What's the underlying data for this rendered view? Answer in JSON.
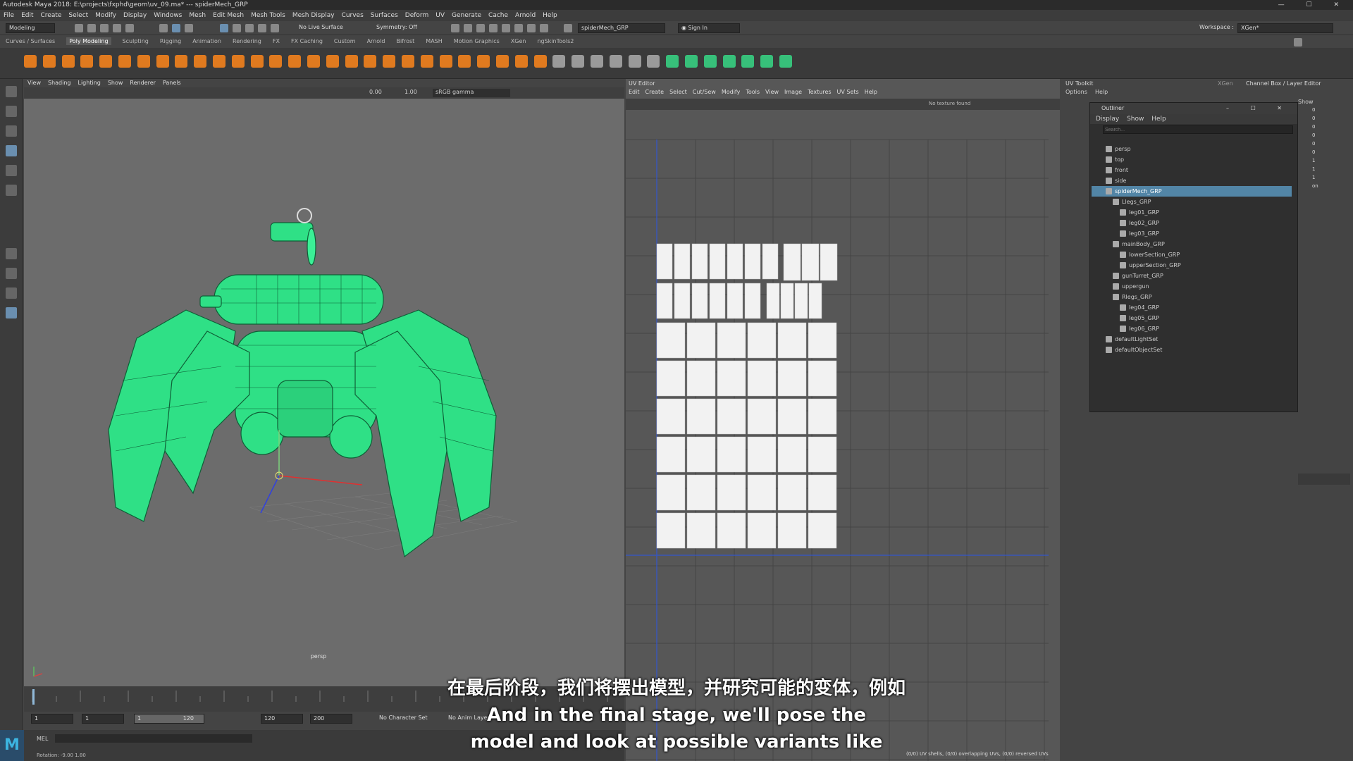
{
  "window_title": "Autodesk Maya 2018: E:\\projects\\fxphd\\geom\\uv_09.ma*   ---   spiderMech_GRP",
  "menus": [
    "File",
    "Edit",
    "Create",
    "Select",
    "Modify",
    "Display",
    "Windows",
    "Mesh",
    "Edit Mesh",
    "Mesh Tools",
    "Mesh Display",
    "Curves",
    "Surfaces",
    "Deform",
    "UV",
    "Generate",
    "Cache",
    "Arnold",
    "Help"
  ],
  "statusline": {
    "mode": "Modeling",
    "live_surface": "No Live Surface",
    "symmetry": "Symmetry: Off",
    "object_field": "spiderMech_GRP",
    "sign_in": "Sign In",
    "workspace_label": "Workspace :",
    "workspace_value": "XGen*"
  },
  "shelf_tabs": [
    "Curves / Surfaces",
    "Poly Modeling",
    "Sculpting",
    "Rigging",
    "Animation",
    "Rendering",
    "FX",
    "FX Caching",
    "Custom",
    "Arnold",
    "Bifrost",
    "MASH",
    "Motion Graphics",
    "XGen",
    "ngSkinTools2"
  ],
  "shelf_active": "Poly Modeling",
  "viewport": {
    "menus": [
      "View",
      "Shading",
      "Lighting",
      "Show",
      "Renderer",
      "Panels"
    ],
    "exposure": "0.00",
    "gamma": "1.00",
    "colorspace": "sRGB gamma",
    "camera_label": "persp"
  },
  "uv_editor": {
    "title": "UV Editor",
    "menus": [
      "Edit",
      "Create",
      "Select",
      "Cut/Sew",
      "Modify",
      "Tools",
      "View",
      "Image",
      "Textures",
      "UV Sets",
      "Help"
    ],
    "texture_status": "No texture found",
    "status_text": "(0/0) UV shells, (0/0) overlapping UVs, (0/0) reversed UVs"
  },
  "uv_toolkit": {
    "title": "UV Toolkit",
    "xgen_tab": "XGen",
    "channel_box_tab": "Channel Box / Layer Editor",
    "menus": [
      "Options",
      "Help"
    ],
    "show_label": "Show"
  },
  "outliner": {
    "title": "Outliner",
    "menus": [
      "Display",
      "Show",
      "Help"
    ],
    "search_placeholder": "Search...",
    "items": [
      {
        "label": "persp",
        "indent": 0
      },
      {
        "label": "top",
        "indent": 0
      },
      {
        "label": "front",
        "indent": 0
      },
      {
        "label": "side",
        "indent": 0
      },
      {
        "label": "spiderMech_GRP",
        "indent": 0,
        "selected": true
      },
      {
        "label": "Llegs_GRP",
        "indent": 1
      },
      {
        "label": "leg01_GRP",
        "indent": 2
      },
      {
        "label": "leg02_GRP",
        "indent": 2
      },
      {
        "label": "leg03_GRP",
        "indent": 2
      },
      {
        "label": "mainBody_GRP",
        "indent": 1
      },
      {
        "label": "lowerSection_GRP",
        "indent": 2
      },
      {
        "label": "upperSection_GRP",
        "indent": 2
      },
      {
        "label": "gunTurret_GRP",
        "indent": 1
      },
      {
        "label": "uppergun",
        "indent": 1
      },
      {
        "label": "Rlegs_GRP",
        "indent": 1
      },
      {
        "label": "leg04_GRP",
        "indent": 2
      },
      {
        "label": "leg05_GRP",
        "indent": 2
      },
      {
        "label": "leg06_GRP",
        "indent": 2
      },
      {
        "label": "defaultLightSet",
        "indent": 0
      },
      {
        "label": "defaultObjectSet",
        "indent": 0
      }
    ]
  },
  "channel_values": [
    "0",
    "0",
    "0",
    "0",
    "0",
    "0",
    "1",
    "1",
    "1",
    "on"
  ],
  "range": {
    "start": "1",
    "current": "1",
    "range_start": "1",
    "range_end": "120",
    "end": "120",
    "anim_end": "200",
    "character_set": "No Character Set",
    "anim_layer": "No Anim Layer"
  },
  "command_line": {
    "lang": "MEL",
    "rotation": "Rotation:  -9.00    1.80"
  },
  "subtitles": {
    "zh": "在最后阶段，我们将摆出模型，并研究可能的变体，例如",
    "en1": "And in the final stage, we'll pose the",
    "en2": "model and look at possible variants like"
  },
  "colors": {
    "wire_green": "#2fe086",
    "outliner_select": "#5285a6",
    "maya_orange": "#e07a1f",
    "shelf_green": "#37c07a"
  }
}
